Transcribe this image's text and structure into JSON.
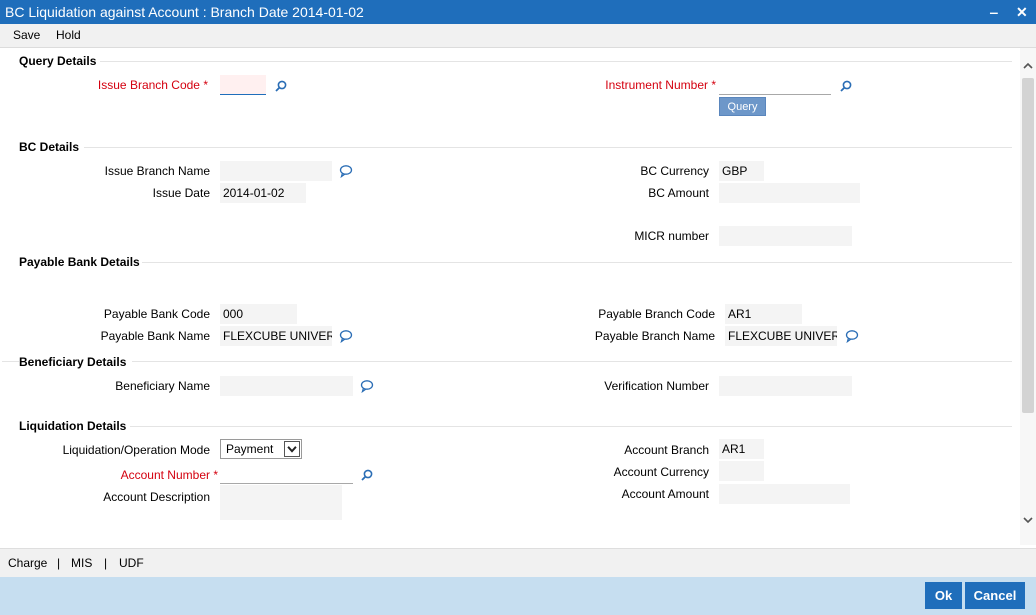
{
  "window": {
    "title": "BC Liquidation against Account : Branch Date 2014-01-02",
    "minimize": "‒",
    "close": "✕"
  },
  "menu": {
    "save": "Save",
    "hold": "Hold"
  },
  "query_details": {
    "heading": "Query Details",
    "issue_branch_code_label": "Issue Branch Code",
    "issue_branch_code_value": "",
    "instrument_number_label": "Instrument Number",
    "instrument_number_value": "",
    "required_mark": "*",
    "query_button": "Query"
  },
  "bc_details": {
    "heading": "BC Details",
    "issue_branch_name_label": "Issue Branch Name",
    "issue_branch_name_value": "",
    "issue_date_label": "Issue Date",
    "issue_date_value": "2014-01-02",
    "bc_currency_label": "BC Currency",
    "bc_currency_value": "GBP",
    "bc_amount_label": "BC Amount",
    "bc_amount_value": "",
    "micr_number_label": "MICR number",
    "micr_number_value": ""
  },
  "payable_bank_details": {
    "heading": "Payable Bank Details",
    "payable_bank_code_label": "Payable Bank Code",
    "payable_bank_code_value": "000",
    "payable_bank_name_label": "Payable Bank Name",
    "payable_bank_name_value": "FLEXCUBE UNIVER",
    "payable_branch_code_label": "Payable Branch Code",
    "payable_branch_code_value": "AR1",
    "payable_branch_name_label": "Payable Branch Name",
    "payable_branch_name_value": "FLEXCUBE UNIVER"
  },
  "beneficiary_details": {
    "heading": "Beneficiary Details",
    "beneficiary_name_label": "Beneficiary Name",
    "beneficiary_name_value": "",
    "verification_number_label": "Verification Number",
    "verification_number_value": ""
  },
  "liquidation_details": {
    "heading": "Liquidation Details",
    "mode_label": "Liquidation/Operation Mode",
    "mode_value": "Payment",
    "account_number_label": "Account Number",
    "account_number_value": "",
    "account_description_label": "Account Description",
    "account_description_value": "",
    "account_branch_label": "Account Branch",
    "account_branch_value": "AR1",
    "account_currency_label": "Account Currency",
    "account_currency_value": "",
    "account_amount_label": "Account Amount",
    "account_amount_value": ""
  },
  "tabs": {
    "charge": "Charge",
    "mis": "MIS",
    "udf": "UDF",
    "divider": "|"
  },
  "footer": {
    "ok": "Ok",
    "cancel": "Cancel"
  },
  "colors": {
    "title_bg": "#1f6ebb",
    "required": "#d4000f",
    "footer_bg": "#c6def0"
  }
}
